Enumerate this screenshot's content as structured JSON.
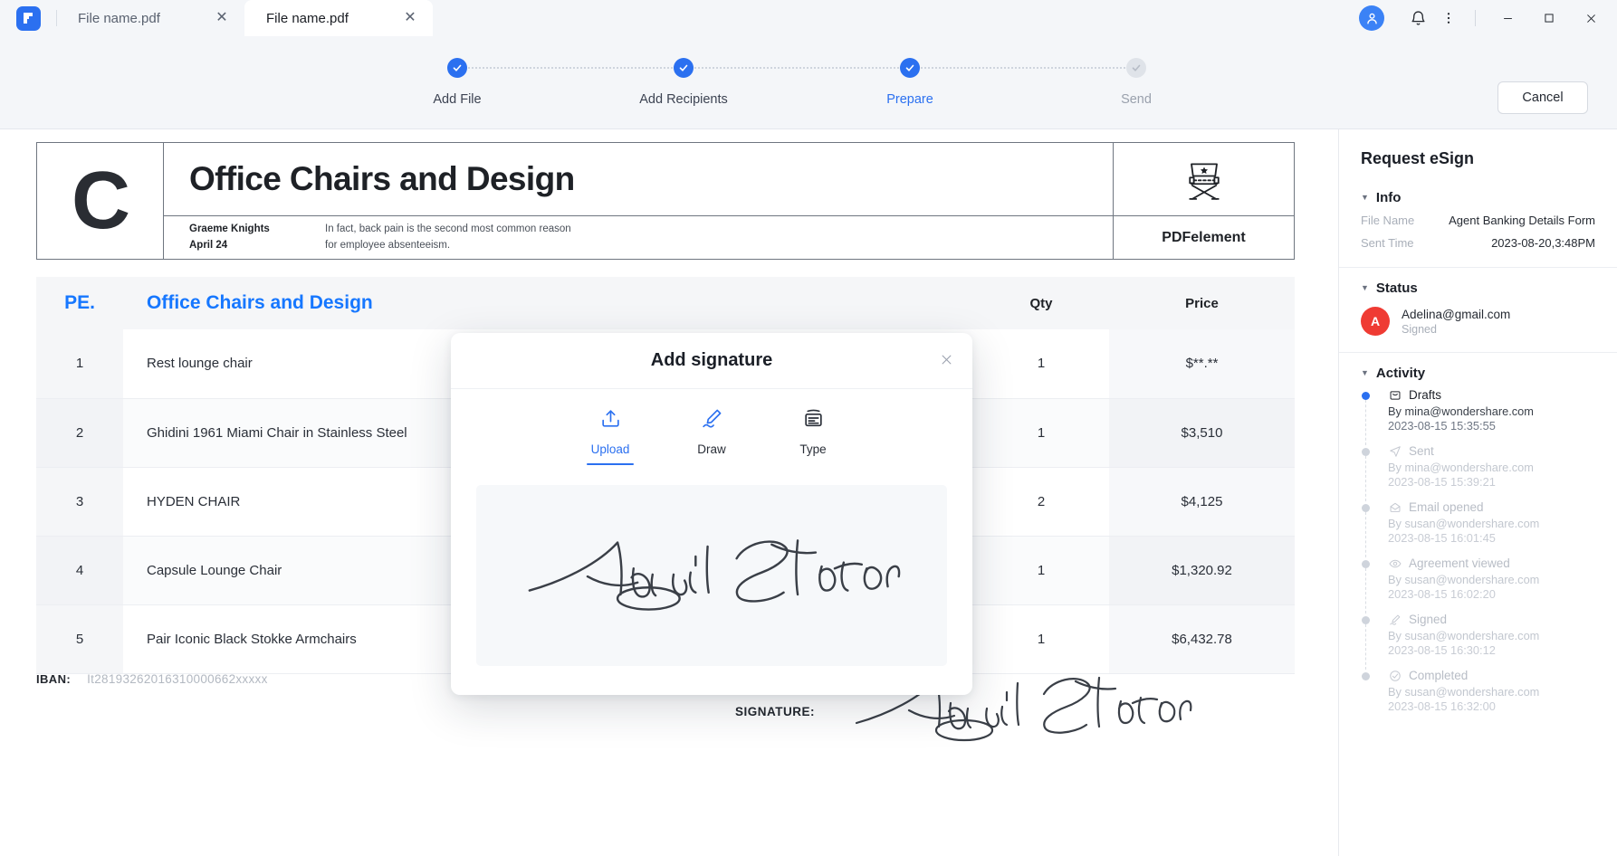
{
  "titlebar": {
    "tabs": [
      {
        "label": "File name.pdf",
        "active": false
      },
      {
        "label": "File name.pdf",
        "active": true
      }
    ],
    "close_glyph": "✕",
    "avatar_icon": "user-avatar-icon",
    "bell_icon": "bell-icon",
    "more_icon": "more-vertical-icon",
    "minimize_glyph": "—",
    "maximize_glyph": "□",
    "close_window_glyph": "✕"
  },
  "steps": {
    "items": [
      {
        "label": "Add File",
        "state": "done"
      },
      {
        "label": "Add Recipients",
        "state": "done"
      },
      {
        "label": "Prepare",
        "state": "current"
      },
      {
        "label": "Send",
        "state": "pending"
      }
    ],
    "cancel_label": "Cancel"
  },
  "document": {
    "monogram": "C",
    "title": "Office Chairs and Design",
    "author_name": "Graeme Knights",
    "author_date": "April 24",
    "note_line1": "In fact, back pain is the second most common reason",
    "note_line2": "for employee absenteeism.",
    "brand": "PDFelement",
    "brand_icon": "director-chair-icon",
    "table": {
      "headers": {
        "num": "PE.",
        "item": "Office Chairs and Design",
        "qty": "Qty",
        "price": "Price"
      },
      "rows": [
        {
          "num": "1",
          "item": "Rest lounge chair",
          "qty": "1",
          "price": "$**.**"
        },
        {
          "num": "2",
          "item": "Ghidini 1961 Miami Chair in Stainless Steel",
          "qty": "1",
          "price": "$3,510"
        },
        {
          "num": "3",
          "item": "HYDEN CHAIR",
          "qty": "2",
          "price": "$4,125"
        },
        {
          "num": "4",
          "item": "Capsule Lounge Chair",
          "qty": "1",
          "price": "$1,320.92"
        },
        {
          "num": "5",
          "item": "Pair Iconic Black Stokke Armchairs",
          "qty": "1",
          "price": "$6,432.78"
        }
      ]
    },
    "iban_label": "IBAN:",
    "iban_value": "It28193262016310000662xxxxx",
    "signature_label": "SIGNATURE:",
    "signature_name": "Abigail Stanton"
  },
  "modal": {
    "title": "Add signature",
    "close_glyph": "✕",
    "tabs": [
      {
        "label": "Upload",
        "icon": "upload-icon",
        "active": true
      },
      {
        "label": "Draw",
        "icon": "pen-draw-icon",
        "active": false
      },
      {
        "label": "Type",
        "icon": "keyboard-type-icon",
        "active": false
      }
    ],
    "preview_signature": "Abigail Stanton"
  },
  "sidebar": {
    "title": "Request eSign",
    "info": {
      "heading": "Info",
      "rows": [
        {
          "key": "File Name",
          "value": "Agent Banking Details Form"
        },
        {
          "key": "Sent Time",
          "value": "2023-08-20,3:48PM"
        }
      ]
    },
    "status": {
      "heading": "Status",
      "avatar_letter": "A",
      "email": "Adelina@gmail.com",
      "state": "Signed",
      "avatar_color": "#ef3b33"
    },
    "activity": {
      "heading": "Activity",
      "items": [
        {
          "title": "Drafts",
          "icon": "drafts-icon",
          "by": "By mina@wondershare.com",
          "time": "2023-08-15 15:35:55",
          "state": "active"
        },
        {
          "title": "Sent",
          "icon": "send-icon",
          "by": "By mina@wondershare.com",
          "time": "2023-08-15 15:39:21",
          "state": "dim"
        },
        {
          "title": "Email opened",
          "icon": "envelope-open-icon",
          "by": "By susan@wondershare.com",
          "time": "2023-08-15 16:01:45",
          "state": "dim"
        },
        {
          "title": "Agreement viewed",
          "icon": "eye-icon",
          "by": "By susan@wondershare.com",
          "time": "2023-08-15 16:02:20",
          "state": "dim"
        },
        {
          "title": "Signed",
          "icon": "signature-icon",
          "by": "By susan@wondershare.com",
          "time": "2023-08-15 16:30:12",
          "state": "dim"
        },
        {
          "title": "Completed",
          "icon": "check-circle-icon",
          "by": "By susan@wondershare.com",
          "time": "2023-08-15 16:32:00",
          "state": "dim"
        }
      ]
    }
  },
  "colors": {
    "accent": "#2b70f0",
    "link": "#1677ff",
    "status_avatar": "#ef3b33",
    "muted": "#a9afb9"
  }
}
